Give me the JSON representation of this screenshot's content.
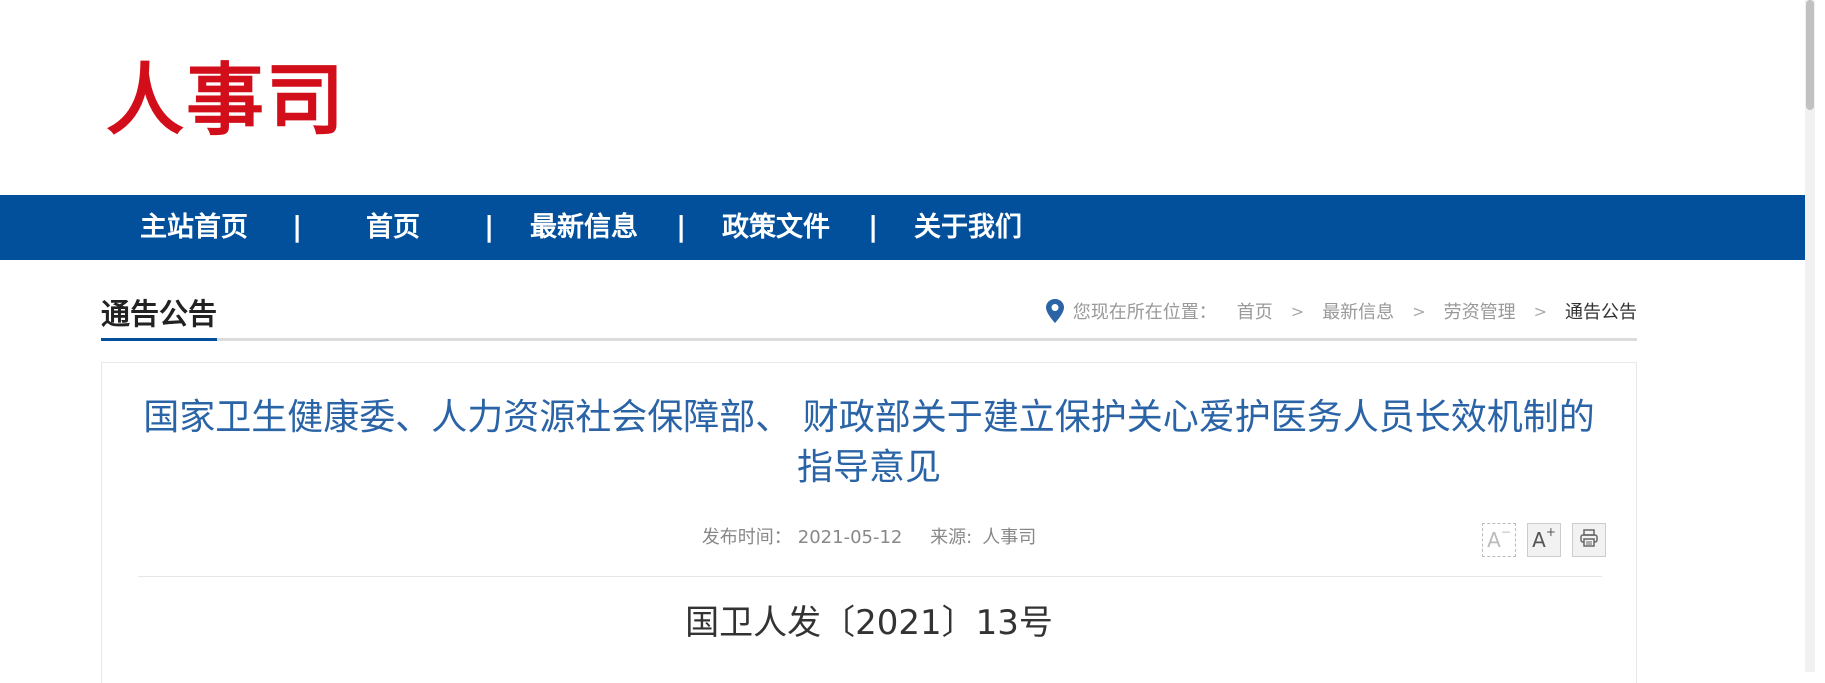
{
  "header": {
    "logo_text": "人事司"
  },
  "nav": {
    "items": [
      {
        "label": "主站首页"
      },
      {
        "label": "首页"
      },
      {
        "label": "最新信息"
      },
      {
        "label": "政策文件"
      },
      {
        "label": "关于我们"
      }
    ],
    "separator": "|"
  },
  "section": {
    "title": "通告公告"
  },
  "breadcrumb": {
    "label": "您现在所在位置：",
    "items": [
      "首页",
      "最新信息",
      "劳资管理"
    ],
    "current": "通告公告",
    "separator": ">",
    "icon": "location-pin-icon"
  },
  "article": {
    "title": "国家卫生健康委、人力资源社会保障部、 财政部关于建立保护关心爱护医务人员长效机制的指导意见",
    "publish_label": "发布时间：",
    "publish_date": "2021-05-12",
    "source_label": "来源:",
    "source": "人事司",
    "doc_number": "国卫人发〔2021〕13号"
  },
  "tools": {
    "font_decrease": "A",
    "font_decrease_sup": "−",
    "font_increase": "A",
    "font_increase_sup": "+",
    "print_icon": "printer-icon"
  },
  "colors": {
    "brand_red": "#d20e1a",
    "nav_blue": "#02509b",
    "title_blue": "#2a64a6"
  }
}
